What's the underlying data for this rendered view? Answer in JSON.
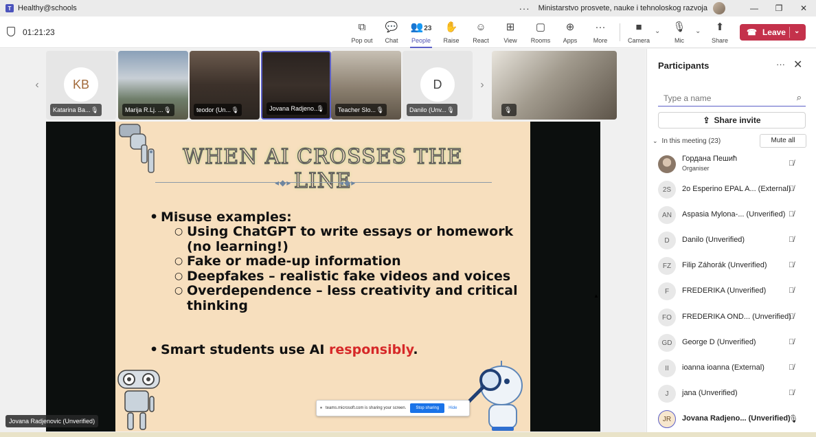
{
  "window": {
    "app_name": "Healthy@schools",
    "app_logo_letter": "T",
    "organization": "Ministarstvo prosvete, nauke i tehnoloskog razvoja",
    "more": "···",
    "minimize": "—",
    "maximize": "❐",
    "close": "✕"
  },
  "toolbar": {
    "timer": "01:21:23",
    "pop_out": "Pop out",
    "chat": "Chat",
    "people": "People",
    "people_count": "23",
    "raise": "Raise",
    "react": "React",
    "view": "View",
    "rooms": "Rooms",
    "apps": "Apps",
    "more": "More",
    "camera": "Camera",
    "mic": "Mic",
    "share": "Share",
    "leave": "Leave",
    "active_tab": "People"
  },
  "video_strip": {
    "tiles": [
      {
        "initials": "KB",
        "name": "Katarina Ba..."
      },
      {
        "name": "Marija R.Lj. ..."
      },
      {
        "name": "teodor (Un..."
      },
      {
        "name": "Jovana Radjeno..."
      },
      {
        "name": "Teacher Slo..."
      },
      {
        "initials": "D",
        "name": "Danilo (Unv..."
      }
    ]
  },
  "slide": {
    "title": "WHEN AI CROSSES THE LINE",
    "heading": "Misuse examples:",
    "sub_items": [
      "Using ChatGPT to write essays or homework (no learning!)",
      "Fake or made-up information",
      "Deepfakes – realistic fake videos and voices",
      "Overdependence – less creativity and critical thinking"
    ],
    "closing_prefix": "Smart students use AI ",
    "closing_highlight": "responsibly",
    "closing_suffix": ".",
    "highlight_color": "#d62828"
  },
  "share_banner": {
    "text": "teams.microsoft.com is sharing your screen.",
    "stop_button": "Stop sharing",
    "hide_button": "Hide"
  },
  "presenter_label": "Jovana Radjenovic (Unverified)",
  "participants": {
    "title": "Participants",
    "search_placeholder": "Type a name",
    "share_invite": "Share invite",
    "section_label": "In this meeting (23)",
    "mute_all": "Mute all",
    "list": [
      {
        "avatar": "photo",
        "name": "Гордана Пешић",
        "role": "Organiser",
        "mic": "off"
      },
      {
        "avatar": "2S",
        "name": "2o Esperino EPAL A... (External)",
        "mic": "off"
      },
      {
        "avatar": "AN",
        "name": "Aspasia Mylona-... (Unverified)",
        "mic": "off"
      },
      {
        "avatar": "D",
        "name": "Danilo (Unverified)",
        "mic": "off"
      },
      {
        "avatar": "FZ",
        "name": "Filip Záhorák (Unverified)",
        "mic": "off"
      },
      {
        "avatar": "F",
        "name": "FREDERIKA (Unverified)",
        "mic": "off"
      },
      {
        "avatar": "FO",
        "name": "FREDERIKA OND... (Unverified)",
        "mic": "off"
      },
      {
        "avatar": "GD",
        "name": "George D (Unverified)",
        "mic": "off"
      },
      {
        "avatar": "II",
        "name": "ioanna ioanna (External)",
        "mic": "off"
      },
      {
        "avatar": "J",
        "name": "jana (Unverified)",
        "mic": "off"
      },
      {
        "avatar": "JR",
        "name": "Jovana Radjeno... (Unverified)",
        "mic": "on"
      }
    ]
  },
  "colors": {
    "accent": "#5b5fc7",
    "leave": "#c4314b",
    "slide_bg": "#f7dfbe"
  }
}
